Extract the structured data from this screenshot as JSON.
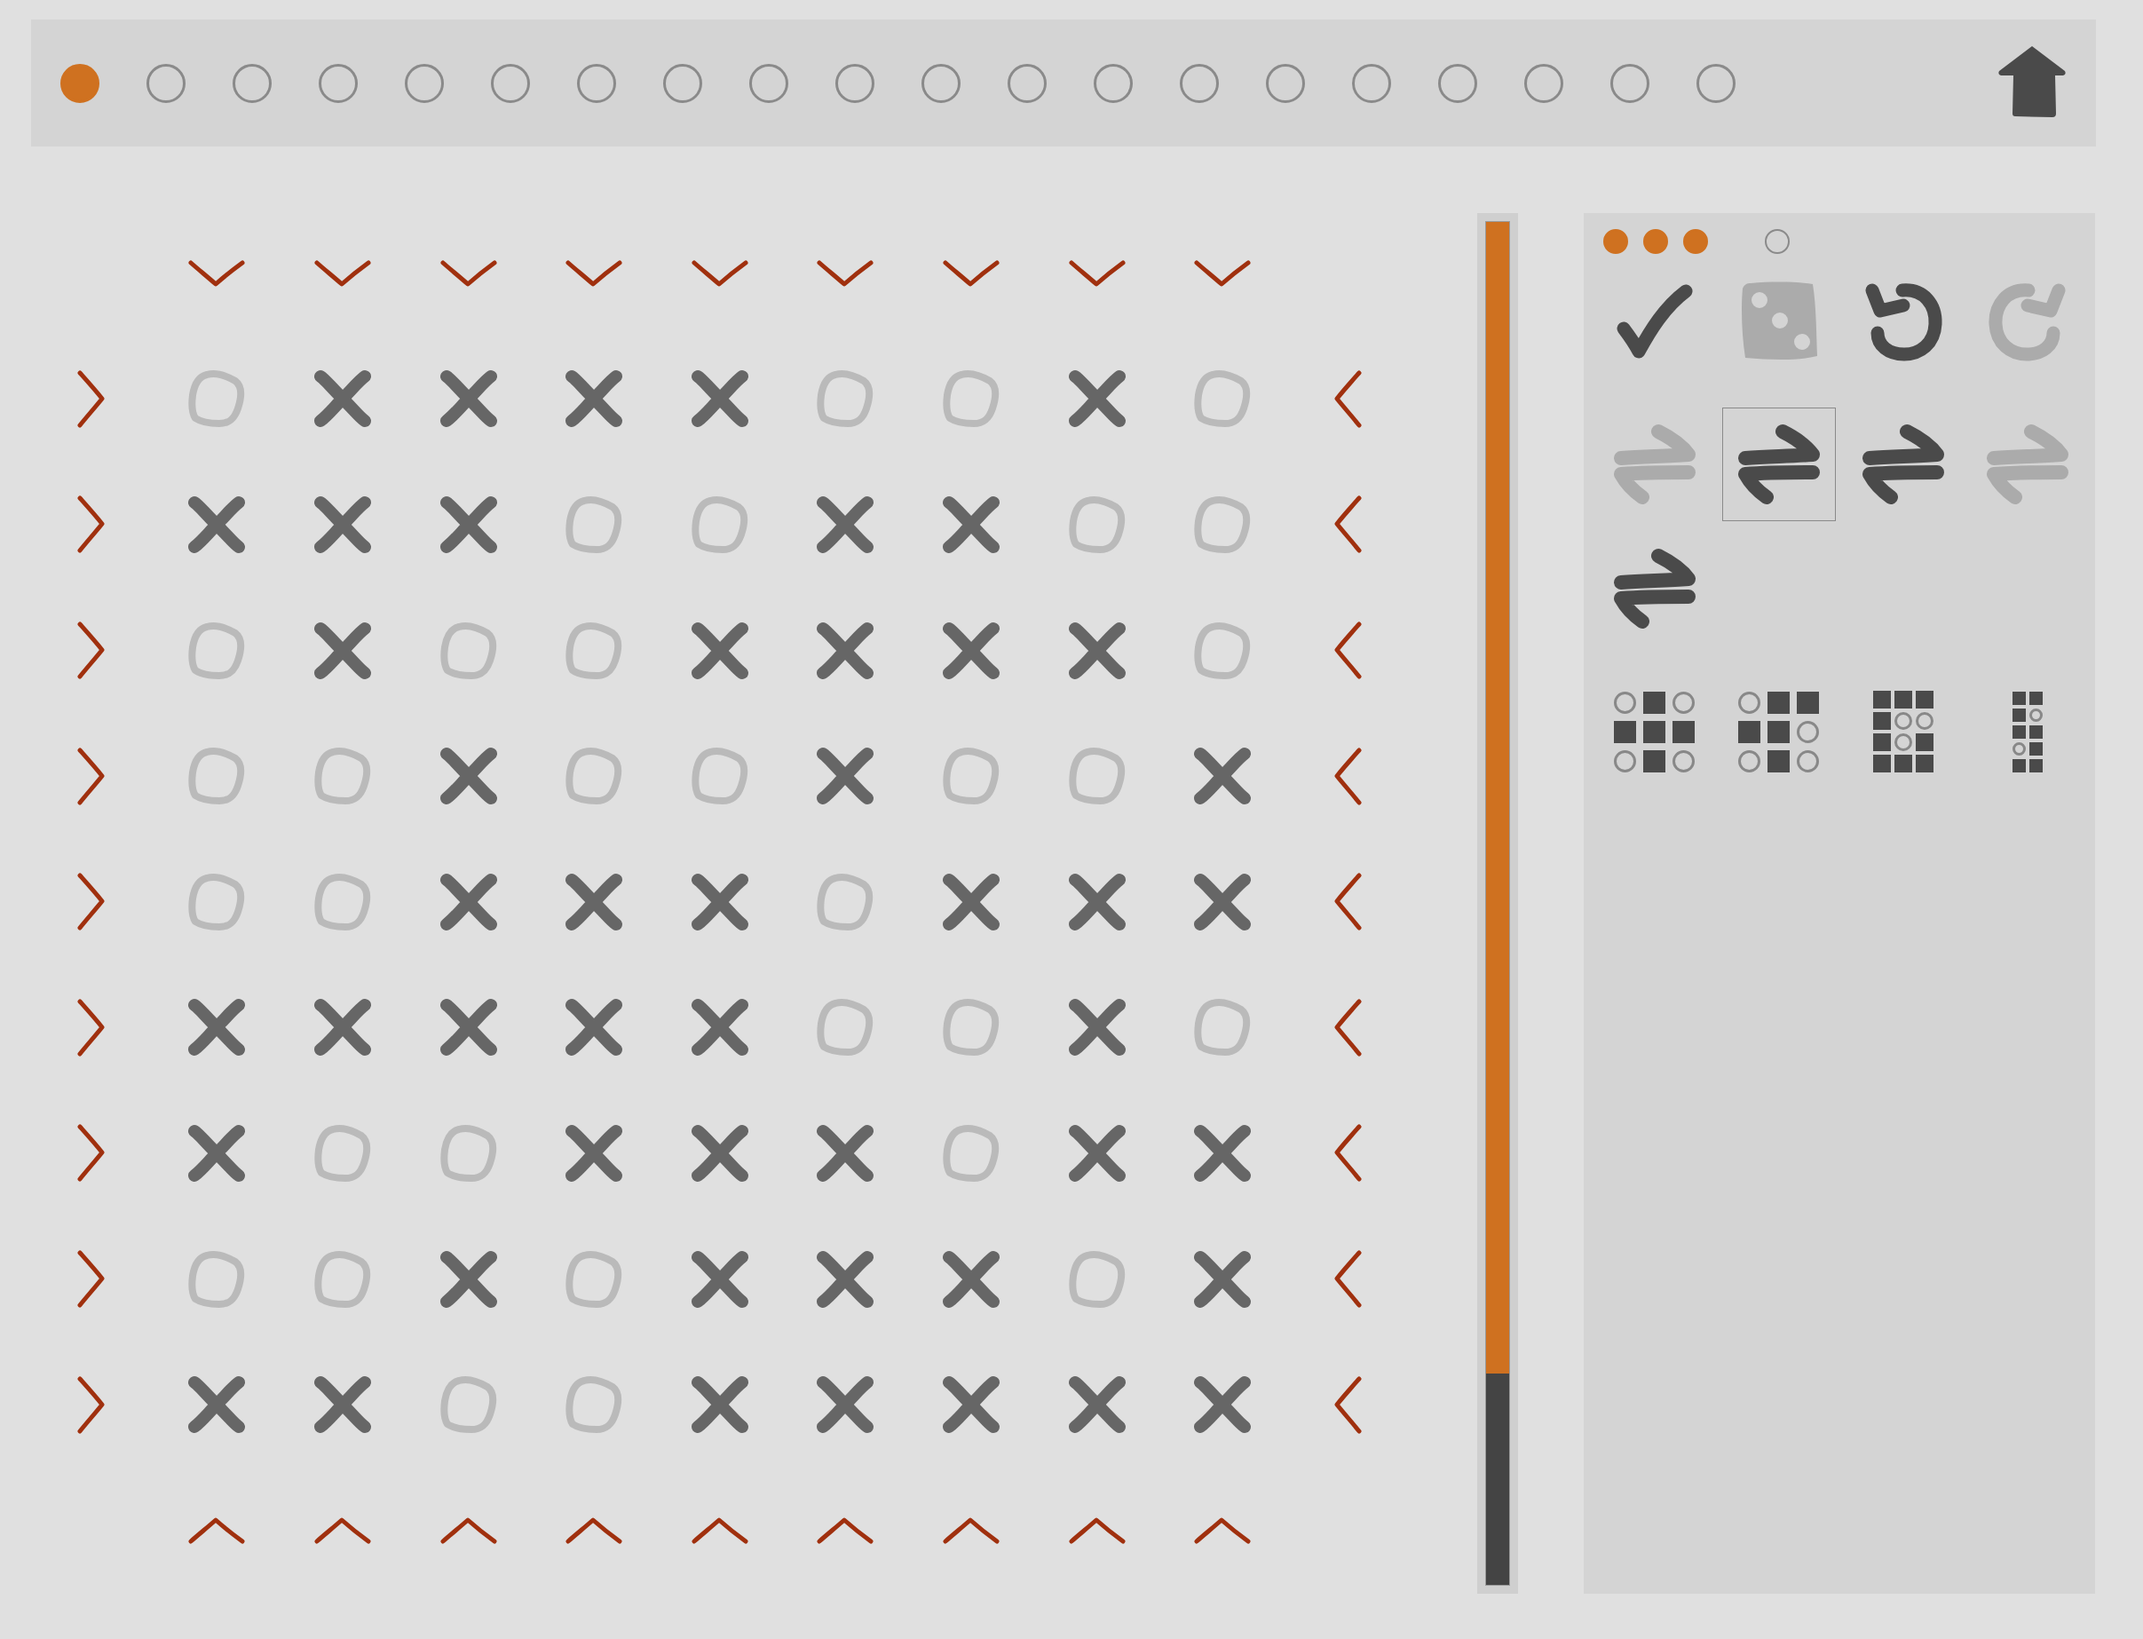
{
  "levels": [
    {
      "selected": true
    },
    {
      "selected": false
    },
    {
      "selected": false
    },
    {
      "selected": false
    },
    {
      "selected": false
    },
    {
      "selected": false
    },
    {
      "selected": false
    },
    {
      "selected": false
    },
    {
      "selected": false
    },
    {
      "selected": false
    },
    {
      "selected": false
    },
    {
      "selected": false
    },
    {
      "selected": false
    },
    {
      "selected": false
    },
    {
      "selected": false
    },
    {
      "selected": false
    },
    {
      "selected": false
    },
    {
      "selected": false
    },
    {
      "selected": false
    },
    {
      "selected": false
    }
  ],
  "board": {
    "rows": [
      [
        {
          "crossed": false
        },
        {
          "crossed": true
        },
        {
          "crossed": true
        },
        {
          "crossed": true
        },
        {
          "crossed": true
        },
        {
          "crossed": false
        },
        {
          "crossed": false
        },
        {
          "crossed": true
        },
        {
          "crossed": false
        }
      ],
      [
        {
          "crossed": true
        },
        {
          "crossed": true
        },
        {
          "crossed": true
        },
        {
          "crossed": false
        },
        {
          "crossed": false
        },
        {
          "crossed": true
        },
        {
          "crossed": true
        },
        {
          "crossed": false
        },
        {
          "crossed": false
        }
      ],
      [
        {
          "crossed": false
        },
        {
          "crossed": true
        },
        {
          "crossed": false
        },
        {
          "crossed": false
        },
        {
          "crossed": true
        },
        {
          "crossed": true
        },
        {
          "crossed": true
        },
        {
          "crossed": true
        },
        {
          "crossed": false
        }
      ],
      [
        {
          "crossed": false
        },
        {
          "crossed": false
        },
        {
          "crossed": true
        },
        {
          "crossed": false
        },
        {
          "crossed": false
        },
        {
          "crossed": true
        },
        {
          "crossed": false
        },
        {
          "crossed": false
        },
        {
          "crossed": true
        }
      ],
      [
        {
          "crossed": false
        },
        {
          "crossed": false
        },
        {
          "crossed": true
        },
        {
          "crossed": true
        },
        {
          "crossed": true
        },
        {
          "crossed": false
        },
        {
          "crossed": true
        },
        {
          "crossed": true
        },
        {
          "crossed": true
        }
      ],
      [
        {
          "crossed": true
        },
        {
          "crossed": true
        },
        {
          "crossed": true
        },
        {
          "crossed": true
        },
        {
          "crossed": true
        },
        {
          "crossed": false
        },
        {
          "crossed": false
        },
        {
          "crossed": true
        },
        {
          "crossed": false
        }
      ],
      [
        {
          "crossed": true
        },
        {
          "crossed": false
        },
        {
          "crossed": false
        },
        {
          "crossed": true
        },
        {
          "crossed": true
        },
        {
          "crossed": true
        },
        {
          "crossed": false
        },
        {
          "crossed": true
        },
        {
          "crossed": true
        }
      ],
      [
        {
          "crossed": false
        },
        {
          "crossed": false
        },
        {
          "crossed": true
        },
        {
          "crossed": false
        },
        {
          "crossed": true
        },
        {
          "crossed": true
        },
        {
          "crossed": true
        },
        {
          "crossed": false
        },
        {
          "crossed": true
        }
      ],
      [
        {
          "crossed": true
        },
        {
          "crossed": true
        },
        {
          "crossed": false
        },
        {
          "crossed": false
        },
        {
          "crossed": true
        },
        {
          "crossed": true
        },
        {
          "crossed": true
        },
        {
          "crossed": true
        },
        {
          "crossed": true
        }
      ]
    ]
  },
  "timer": {
    "level": 0.845
  },
  "panel": {
    "counters": [
      {
        "filled": true
      },
      {
        "filled": true
      },
      {
        "filled": true
      }
    ],
    "spare_counter": {
      "filled": false
    },
    "actions": [
      {
        "kind": "check",
        "disabled": false
      },
      {
        "kind": "dice",
        "disabled": true
      },
      {
        "kind": "undo",
        "disabled": false
      },
      {
        "kind": "redo",
        "disabled": true
      }
    ],
    "swap_options": [
      {
        "selected": false,
        "disabled": true
      },
      {
        "selected": true,
        "disabled": false
      },
      {
        "selected": false,
        "disabled": false
      },
      {
        "selected": false,
        "disabled": true
      },
      {
        "selected": false,
        "disabled": false
      }
    ],
    "patterns": [
      {
        "kind": "plus"
      },
      {
        "kind": "scatter"
      },
      {
        "kind": "frame"
      },
      {
        "kind": "column"
      }
    ]
  }
}
